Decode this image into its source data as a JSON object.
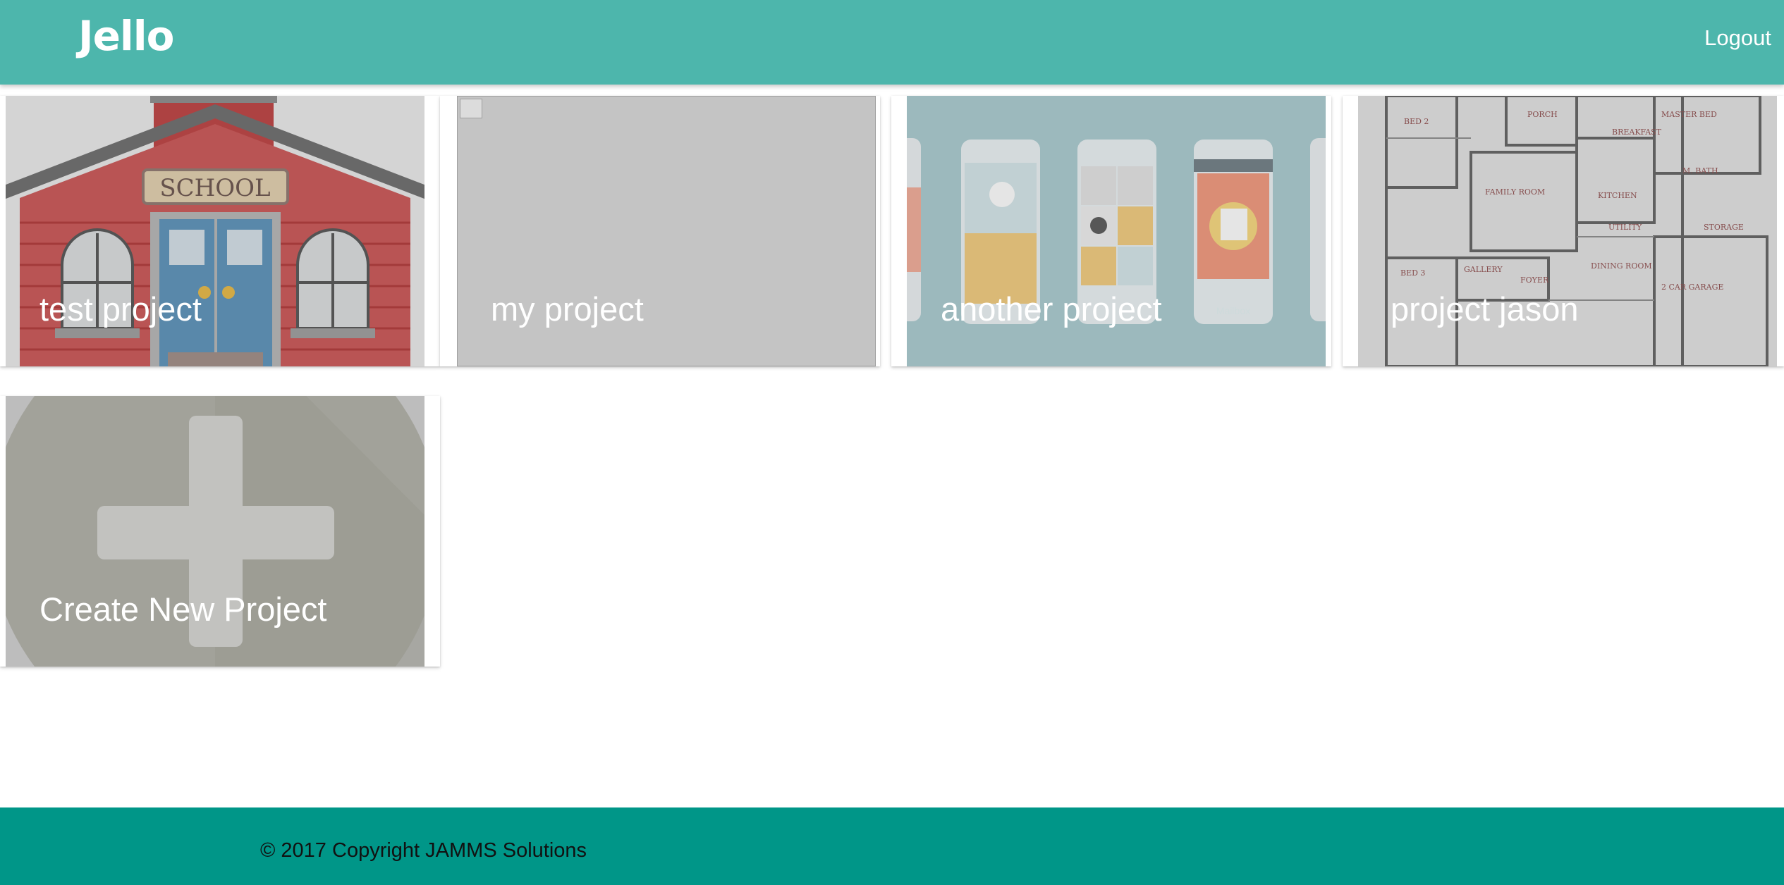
{
  "app": {
    "brand": "Jello",
    "logout_label": "Logout"
  },
  "projects": [
    {
      "title": "test project",
      "image": "school-building"
    },
    {
      "title": "my project",
      "image": "broken-image"
    },
    {
      "title": "another project",
      "image": "phone-app-mockups"
    },
    {
      "title": "project jason",
      "image": "house-floor-plan"
    }
  ],
  "create_card": {
    "title": "Create New Project",
    "image": "plus-icon"
  },
  "footer": {
    "copyright": "© 2017 Copyright JAMMS Solutions"
  },
  "colors": {
    "navbar": "#4db6ac",
    "footer": "#009688",
    "text_on_primary": "#ffffff"
  }
}
